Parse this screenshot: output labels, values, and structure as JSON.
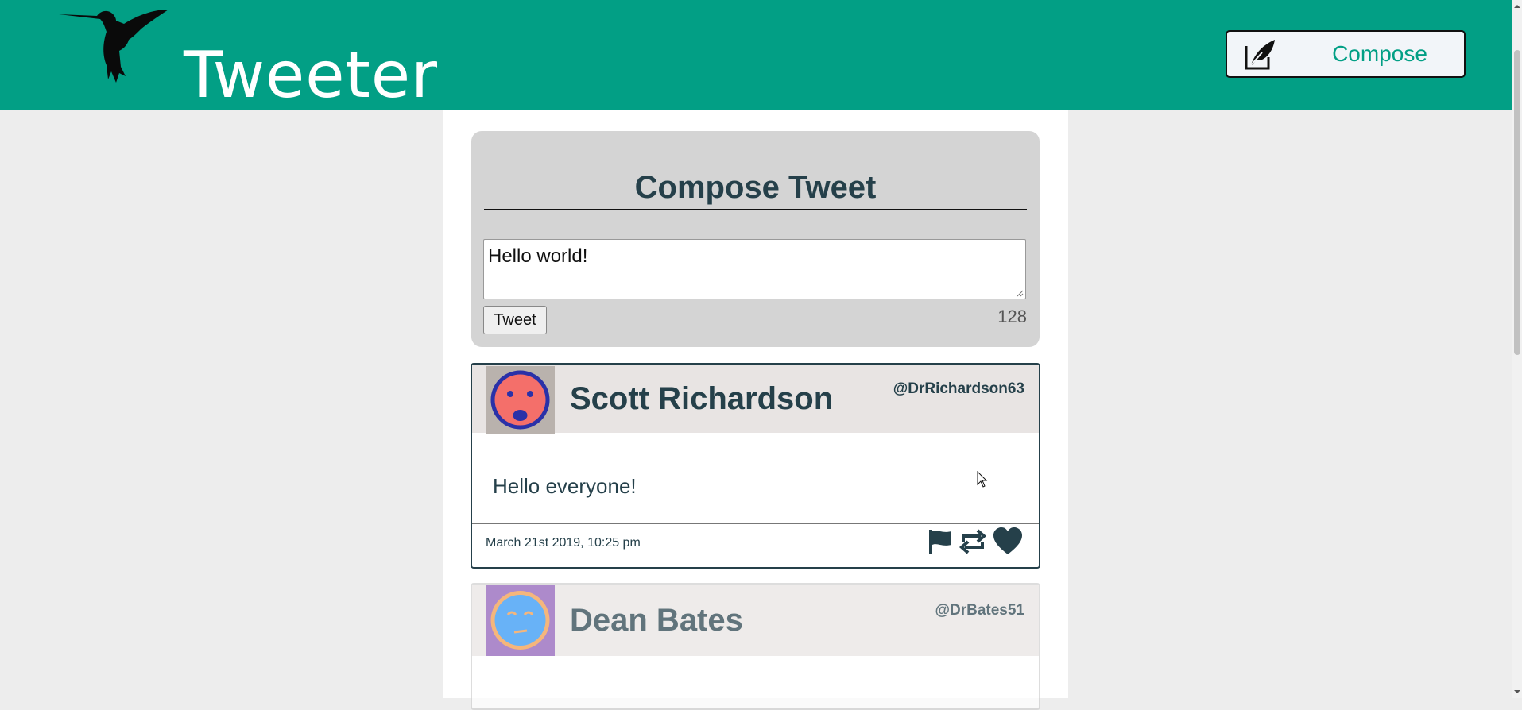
{
  "header": {
    "brand": "Tweeter",
    "compose_label": "Compose",
    "logo_icon": "hummingbird-icon",
    "compose_icon": "quill-edit-icon"
  },
  "compose": {
    "title": "Compose Tweet",
    "textarea_value": "Hello world!",
    "submit_label": "Tweet",
    "char_counter": "128"
  },
  "tweets": [
    {
      "name": "Scott Richardson",
      "handle": "@DrRichardson63",
      "body": "Hello everyone!",
      "date": "March 21st 2019, 10:25 pm",
      "avatar_icon": "frown-face-avatar-icon",
      "actions": [
        "flag-icon",
        "retweet-icon",
        "heart-icon"
      ]
    },
    {
      "name": "Dean Bates",
      "handle": "@DrBates51",
      "avatar_icon": "smirk-face-avatar-icon"
    }
  ],
  "colors": {
    "brand_green": "#029f85",
    "text_dark": "#25404a",
    "page_bg": "#ededed",
    "panel_gray": "#d4d4d4",
    "tweet_header_bg": "#e8e4e3"
  }
}
